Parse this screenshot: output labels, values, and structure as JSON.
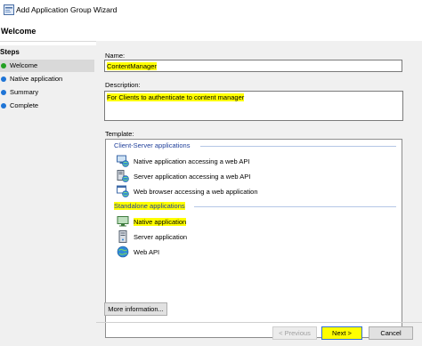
{
  "window": {
    "title": "Add Application Group Wizard"
  },
  "header": {
    "heading": "Welcome"
  },
  "steps": {
    "title": "Steps",
    "items": [
      {
        "label": "Welcome",
        "status": "current"
      },
      {
        "label": "Native application",
        "status": "pending"
      },
      {
        "label": "Summary",
        "status": "pending"
      },
      {
        "label": "Complete",
        "status": "pending"
      }
    ]
  },
  "form": {
    "name_label": "Name:",
    "name_value": "ContentManager",
    "description_label": "Description:",
    "description_value": "For Clients to authenticate to content manager",
    "template_label": "Template:"
  },
  "templates": {
    "client_server_heading": "Client-Server applications",
    "client_server_items": [
      {
        "label": "Native application accessing a web API",
        "icon": "monitor-globe-icon"
      },
      {
        "label": "Server application accessing a web API",
        "icon": "server-globe-icon"
      },
      {
        "label": "Web browser accessing a web application",
        "icon": "browser-globe-icon"
      }
    ],
    "standalone_heading": "Standalone applications",
    "standalone_items": [
      {
        "label": "Native application",
        "icon": "monitor-icon",
        "selected": true
      },
      {
        "label": "Server application",
        "icon": "server-icon",
        "selected": false
      },
      {
        "label": "Web API",
        "icon": "globe-icon",
        "selected": false
      }
    ]
  },
  "buttons": {
    "more_info": "More information...",
    "previous": "< Previous",
    "next": "Next >",
    "cancel": "Cancel"
  },
  "colors": {
    "highlight": "#ffff00",
    "group_heading": "#1f3f9a",
    "step_dot": "#1e74d6",
    "step_dot_current": "#22a022"
  }
}
